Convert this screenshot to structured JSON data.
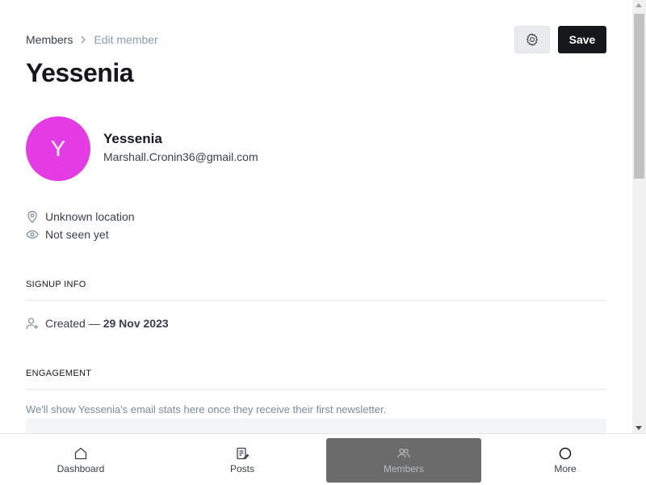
{
  "breadcrumb": {
    "parent": "Members",
    "current": "Edit member"
  },
  "header": {
    "title": "Yessenia",
    "save_label": "Save",
    "settings_icon": "gear-icon"
  },
  "member": {
    "avatar_letter": "Y",
    "avatar_color": "#e53be5",
    "name": "Yessenia",
    "email": "Marshall.Cronin36@gmail.com",
    "location": "Unknown location",
    "last_seen": "Not seen yet"
  },
  "signup": {
    "heading": "SIGNUP INFO",
    "created_label": "Created —",
    "created_date": "29 Nov 2023"
  },
  "engagement": {
    "heading": "ENGAGEMENT",
    "note": "We'll show Yessenia's email stats here once they receive their first newsletter."
  },
  "bottom_nav": {
    "items": [
      {
        "label": "Dashboard",
        "icon": "home-icon"
      },
      {
        "label": "Posts",
        "icon": "posts-icon"
      },
      {
        "label": "Members",
        "icon": "members-icon",
        "active": true
      },
      {
        "label": "More",
        "icon": "more-icon"
      }
    ]
  },
  "colors": {
    "accent_dark": "#15171a",
    "active_nav_bg": "#6b6b6b"
  }
}
